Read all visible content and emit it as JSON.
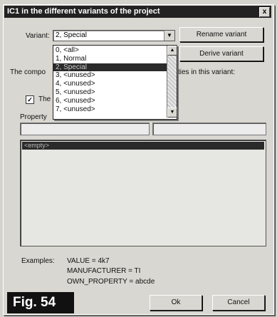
{
  "window": {
    "title": "IC1 in the different variants of the project",
    "close_label": "x"
  },
  "variant": {
    "label": "Variant:",
    "selected": "2, Special",
    "options": [
      "0, <all>",
      "1, Normal",
      "2, Special",
      "3, <unused>",
      "4, <unused>",
      "5, <unused>",
      "6, <unused>",
      "7, <unused>"
    ],
    "selected_index": 2
  },
  "buttons": {
    "rename": "Rename variant",
    "derive": "Derive variant",
    "ok": "Ok",
    "cancel": "Cancel"
  },
  "component_text_left": "The compo",
  "component_text_right": "ties in this variant:",
  "checkbox": {
    "label": "The",
    "checked": true,
    "mark": "✓"
  },
  "property_label": "Property",
  "list": {
    "items": [
      "<empty>"
    ]
  },
  "examples": {
    "label": "Examples:",
    "lines": [
      "VALUE = 4k7",
      "MANUFACTURER = TI",
      "OWN_PROPERTY = abcde"
    ]
  },
  "figure_label": "Fig. 54"
}
